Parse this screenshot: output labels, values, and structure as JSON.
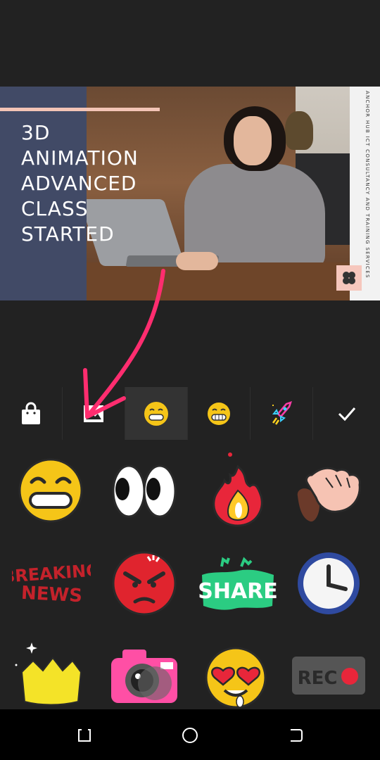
{
  "preview": {
    "title_lines": [
      "3D",
      "ANIMATION",
      "ADVANCED",
      "CLASS",
      "STARTED"
    ],
    "side_text": "ANCHOR HUB ICT CONSULTANCY AND TRAINING SERVICES",
    "colors": {
      "panel": "#414a66",
      "accent_line": "#f3c4b6",
      "logo_bg": "#f6c7bd"
    }
  },
  "annotation": {
    "arrow_color": "#ff2d6f"
  },
  "tabs": [
    {
      "name": "store",
      "icon": "shopping-bag-icon"
    },
    {
      "name": "image",
      "icon": "image-icon"
    },
    {
      "name": "emoji-grin",
      "icon": "grinning-emoji-icon",
      "active": true
    },
    {
      "name": "emoji-teeth",
      "icon": "grimacing-emoji-icon"
    },
    {
      "name": "rocket",
      "icon": "rocket-sticker-icon"
    },
    {
      "name": "done",
      "icon": "checkmark-icon"
    }
  ],
  "stickers": [
    {
      "name": "grinning-face",
      "icon": "grinning-face-sticker"
    },
    {
      "name": "eyes",
      "icon": "eyes-sticker"
    },
    {
      "name": "fire",
      "icon": "fire-sticker"
    },
    {
      "name": "waving-hand",
      "icon": "waving-hand-sticker"
    },
    {
      "name": "breaking-news",
      "icon": "breaking-news-sticker",
      "text_line1": "BREAKING",
      "text_line2": "NEWS"
    },
    {
      "name": "angry-face",
      "icon": "angry-face-sticker"
    },
    {
      "name": "share",
      "icon": "share-sticker",
      "text": "SHARE"
    },
    {
      "name": "clock",
      "icon": "clock-sticker"
    },
    {
      "name": "crown",
      "icon": "crown-sticker"
    },
    {
      "name": "camera",
      "icon": "camera-sticker"
    },
    {
      "name": "heart-eyes",
      "icon": "heart-eyes-sticker"
    },
    {
      "name": "rec",
      "icon": "rec-sticker",
      "text": "REC"
    }
  ],
  "navbar": {
    "buttons": [
      "recent-apps",
      "home",
      "back"
    ]
  }
}
